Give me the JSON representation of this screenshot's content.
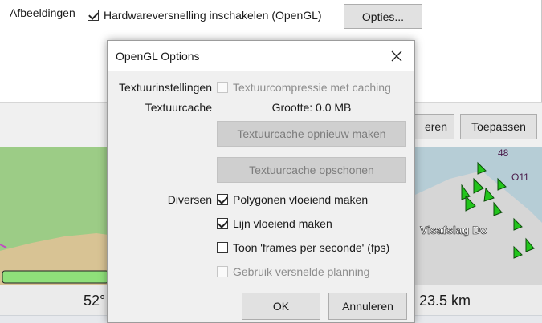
{
  "background": {
    "section_label": "Afbeeldingen",
    "hw_accel_checkbox": {
      "label": "Hardwareversnelling inschakelen (OpenGL)",
      "checked": true
    },
    "options_button": "Opties...",
    "cancel_partial": "eren",
    "apply_button": "Toepassen",
    "status": {
      "left_value": "52°",
      "right_value": "23.5 km"
    },
    "map_label": "Visafslag Do",
    "map_code": "48",
    "map_code2": "O11"
  },
  "dialog": {
    "title": "OpenGL Options",
    "texture_settings": {
      "label": "Textuurinstellingen",
      "compression_checkbox": {
        "label": "Textuurcompressie met caching",
        "checked": false,
        "enabled": false
      }
    },
    "texture_cache": {
      "label": "Textuurcache",
      "size_text": "Grootte: 0.0 MB",
      "rebuild_button": "Textuurcache opnieuw maken",
      "clear_button": "Textuurcache opschonen"
    },
    "misc": {
      "label": "Diversen",
      "polygon_smoothing": {
        "label": "Polygonen vloeiend maken",
        "checked": true
      },
      "line_smoothing": {
        "label": "Lijn vloeiend maken",
        "checked": true
      },
      "show_fps": {
        "label": "Toon 'frames per seconde' (fps)",
        "checked": false
      },
      "accelerated_planning": {
        "label": "Gebruik versnelde planning",
        "checked": false,
        "enabled": false
      }
    },
    "ok_button": "OK",
    "cancel_button": "Annuleren"
  },
  "colors": {
    "map_sea": "#a8c8c6",
    "map_land": "#d8c394",
    "map_green": "#8fdc6a",
    "progress_green": "#8fe07a",
    "marker_green": "#22c51c"
  }
}
